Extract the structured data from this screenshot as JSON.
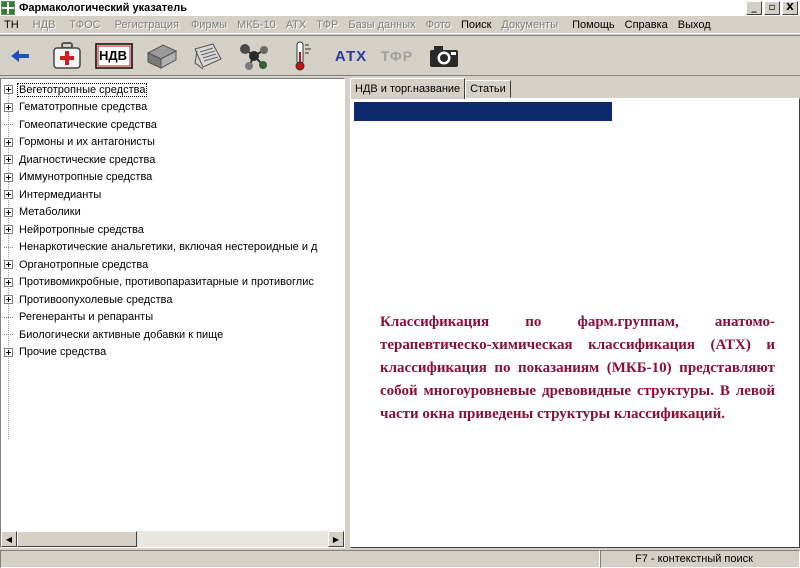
{
  "window": {
    "title": "Фармакологический указатель",
    "buttons": [
      "_",
      "▫",
      "X"
    ]
  },
  "menu": [
    {
      "label": "ТН",
      "disabled": false
    },
    {
      "label": "НДВ",
      "disabled": true
    },
    {
      "label": "ТФОС",
      "disabled": true
    },
    {
      "label": "Регистрация",
      "disabled": true
    },
    {
      "label": "Фирмы",
      "disabled": true
    },
    {
      "label": "МКБ-10",
      "disabled": true
    },
    {
      "label": "АТХ",
      "disabled": true
    },
    {
      "label": "ТФР",
      "disabled": true
    },
    {
      "label": "Базы данных",
      "disabled": true
    },
    {
      "label": "Фото",
      "disabled": true
    },
    {
      "label": "Поиск",
      "disabled": false
    },
    {
      "label": "Документы",
      "disabled": true
    },
    {
      "label": "Помощь",
      "disabled": false
    },
    {
      "label": "Справка",
      "disabled": false
    },
    {
      "label": "Выход",
      "disabled": false
    }
  ],
  "toolbar": {
    "ndv": "НДВ",
    "atx": "АТХ",
    "tfr": "ТФР",
    "icons": [
      "back-arrow-icon",
      "first-aid-kit-icon",
      "ndv-icon",
      "book-icon",
      "catalog-icon",
      "molecule-icon",
      "thermometer-icon",
      "atx-icon",
      "tfr-icon",
      "camera-icon"
    ]
  },
  "tree": [
    {
      "label": "Вегетотропные средства",
      "expandable": true,
      "selected": true
    },
    {
      "label": "Гематотропные средства",
      "expandable": true,
      "selected": false
    },
    {
      "label": "Гомеопатические средства",
      "expandable": false,
      "selected": false
    },
    {
      "label": "Гормоны и их антагонисты",
      "expandable": true,
      "selected": false
    },
    {
      "label": "Диагностические средства",
      "expandable": true,
      "selected": false
    },
    {
      "label": "Иммунотропные средства",
      "expandable": true,
      "selected": false
    },
    {
      "label": "Интермедианты",
      "expandable": true,
      "selected": false
    },
    {
      "label": "Метаболики",
      "expandable": true,
      "selected": false
    },
    {
      "label": "Нейротропные средства",
      "expandable": true,
      "selected": false
    },
    {
      "label": "Ненаркотические анальгетики, включая нестероидные и д",
      "expandable": false,
      "selected": false
    },
    {
      "label": "Органотропные средства",
      "expandable": true,
      "selected": false
    },
    {
      "label": "Противомикробные, противопаразитарные и противоглис",
      "expandable": true,
      "selected": false
    },
    {
      "label": "Противоопухолевые средства",
      "expandable": true,
      "selected": false
    },
    {
      "label": "Регенеранты и репаранты",
      "expandable": false,
      "selected": false
    },
    {
      "label": "Биологически активные добавки к пище",
      "expandable": false,
      "selected": false
    },
    {
      "label": "Прочие средства",
      "expandable": true,
      "selected": false
    }
  ],
  "tabs": [
    {
      "label": "НДВ и торг.название",
      "active": true
    },
    {
      "label": "Статьи",
      "active": false
    }
  ],
  "content": {
    "text": "Классификация по фарм.группам, анатомо-терапевтическо-химическая классификация (АТХ) и классификация по показаниям (МКБ-10) представляют собой многоуровневые древовидные структуры. В левой части окна приведены структуры классификаций."
  },
  "status": {
    "hint": "F7 - контекстный поиск"
  },
  "colors": {
    "content_text": "#8a0f3a",
    "header_bar": "#0c2a6c",
    "atx_text": "#2a3a9a",
    "tfr_text": "#a0a0a0"
  }
}
